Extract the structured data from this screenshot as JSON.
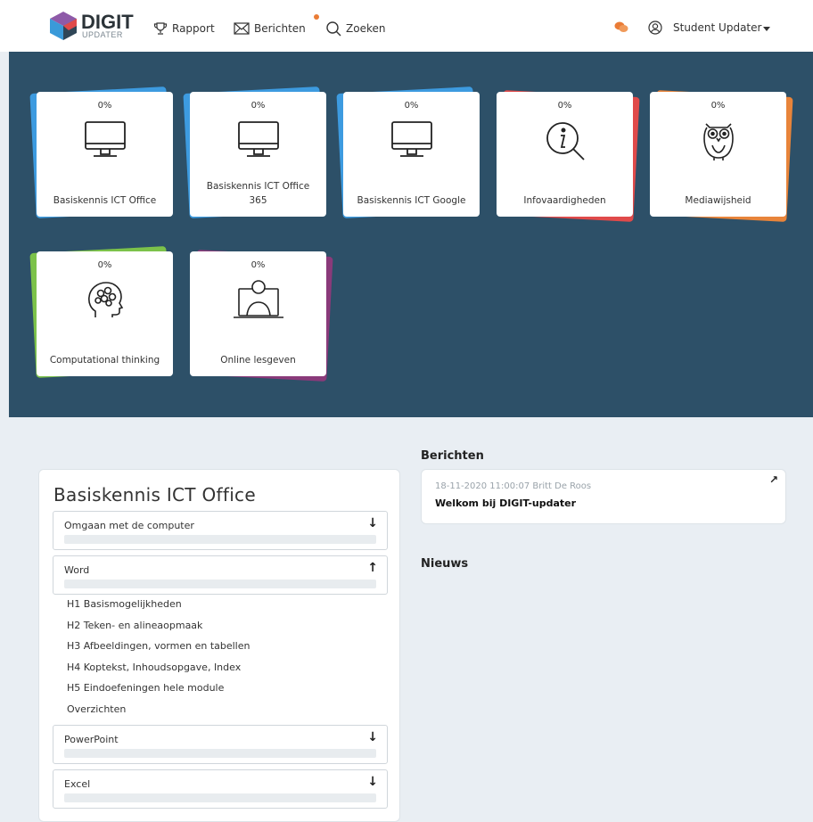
{
  "brand": {
    "name": "DIGIT",
    "sub": "UPDATER"
  },
  "nav": {
    "rapport": "Rapport",
    "berichten": "Berichten",
    "zoeken": "Zoeken",
    "user": "Student Updater"
  },
  "cards": [
    {
      "pct": "0%",
      "title": "Basiskennis ICT Office",
      "icon": "monitor-icon",
      "color": "#3d9be0"
    },
    {
      "pct": "0%",
      "title": "Basiskennis ICT Office 365",
      "icon": "monitor-icon",
      "color": "#3d9be0"
    },
    {
      "pct": "0%",
      "title": "Basiskennis ICT Google",
      "icon": "monitor-icon",
      "color": "#3d9be0"
    },
    {
      "pct": "0%",
      "title": "Infovaardigheden",
      "icon": "info-search-icon",
      "color": "#e04a4a"
    },
    {
      "pct": "0%",
      "title": "Mediawijsheid",
      "icon": "owl-icon",
      "color": "#e8843a"
    },
    {
      "pct": "0%",
      "title": "Computational thinking",
      "icon": "brain-head-icon",
      "color": "#7cc24a"
    },
    {
      "pct": "0%",
      "title": "Online lesgeven",
      "icon": "teacher-screen-icon",
      "color": "#8a3a7a"
    }
  ],
  "module": {
    "title": "Basiskennis ICT Office",
    "sections": [
      {
        "label": "Omgaan met de computer",
        "arrow": "↓",
        "progress": 0
      },
      {
        "label": "Word",
        "arrow": "↑",
        "progress": 0
      },
      {
        "label": "PowerPoint",
        "arrow": "↓",
        "progress": 0
      },
      {
        "label": "Excel",
        "arrow": "↓",
        "progress": 0
      }
    ],
    "word_items": [
      "H1 Basismogelijkheden",
      "H2 Teken- en alineaopmaak",
      "H3 Afbeeldingen, vormen en tabellen",
      "H4 Koptekst, Inhoudsopgave, Index",
      "H5 Eindoefeningen hele module",
      "Overzichten"
    ]
  },
  "berichten": {
    "title": "Berichten",
    "items": [
      {
        "meta": "18-11-2020 11:00:07 Britt De Roos",
        "text": "Welkom bij DIGIT-updater",
        "ext": "↗"
      }
    ]
  },
  "nieuws": {
    "title": "Nieuws"
  },
  "colors": {
    "hero": "#2d5068",
    "accent": "#ea7c36",
    "page": "#e9eef3"
  }
}
